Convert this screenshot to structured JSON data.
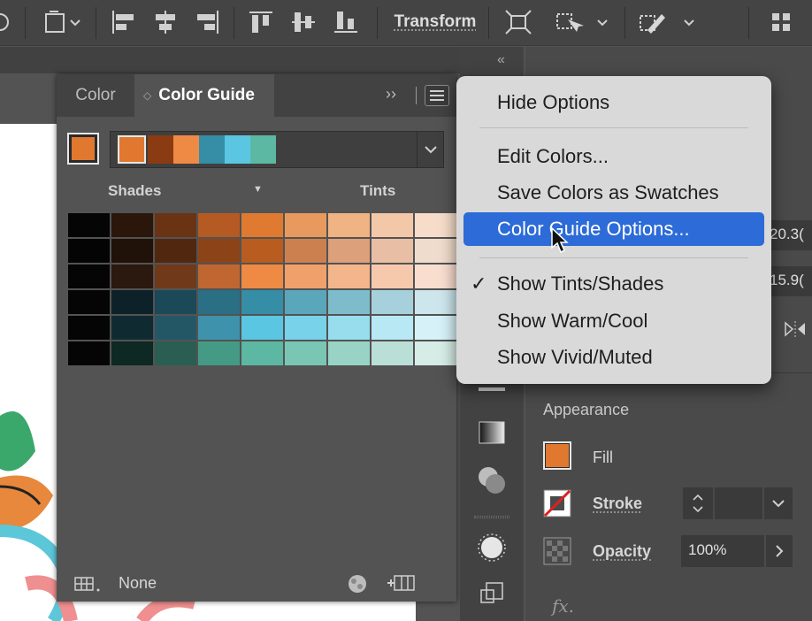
{
  "toolbar": {
    "transform_label": "Transform"
  },
  "panel": {
    "tabs": [
      {
        "label": "Color",
        "active": false
      },
      {
        "label": "Color Guide",
        "active": true
      }
    ],
    "base_color": "#e0782f",
    "harmony_colors": [
      "#e0782f",
      "#8a3b12",
      "#ef8a45",
      "#358ea6",
      "#5ac6e2",
      "#5cb8a2"
    ],
    "shades_label": "Shades",
    "tints_label": "Tints",
    "grid_colors": [
      [
        "#050505",
        "#2a160b",
        "#6a3314",
        "#b45a22",
        "#e07a30",
        "#e89a5e",
        "#efb384",
        "#f3c8a8",
        "#f6dcc9"
      ],
      [
        "#040404",
        "#201208",
        "#512710",
        "#8c4317",
        "#b85c20",
        "#cc8050",
        "#dca07a",
        "#e8bfa4",
        "#f0dccc"
      ],
      [
        "#050505",
        "#2b180e",
        "#70391a",
        "#c06630",
        "#ef8a45",
        "#f0a06a",
        "#f3b58c",
        "#f6c9ad",
        "#f9ded0"
      ],
      [
        "#050505",
        "#0d2228",
        "#1c4957",
        "#2a6f84",
        "#358ea6",
        "#5aa6ba",
        "#7fbccb",
        "#a6d1dc",
        "#cde6ec"
      ],
      [
        "#050505",
        "#102a32",
        "#245766",
        "#3f92ab",
        "#5ac6e2",
        "#78d2e9",
        "#97ddee",
        "#b8e8f3",
        "#d6f2f8"
      ],
      [
        "#050505",
        "#0e2823",
        "#2a5e52",
        "#449a85",
        "#5cb8a2",
        "#7ac6b4",
        "#99d3c5",
        "#badfd6",
        "#d6ece6"
      ]
    ],
    "footer_label": "None"
  },
  "menu": {
    "items": [
      {
        "label": "Hide Options",
        "checked": false,
        "highlighted": false
      },
      {
        "label": "Edit Colors...",
        "checked": false,
        "highlighted": false
      },
      {
        "label": "Save Colors as Swatches",
        "checked": false,
        "highlighted": false
      },
      {
        "label": "Color Guide Options...",
        "checked": false,
        "highlighted": true
      },
      {
        "label": "Show Tints/Shades",
        "checked": true,
        "highlighted": false
      },
      {
        "label": "Show Warm/Cool",
        "checked": false,
        "highlighted": false
      },
      {
        "label": "Show Vivid/Muted",
        "checked": false,
        "highlighted": false
      }
    ],
    "check_glyph": "✓"
  },
  "properties": {
    "value_1": "20.3(",
    "value_2": "15.9(",
    "appearance_label": "Appearance",
    "fill_label": "Fill",
    "fill_color": "#e0782f",
    "stroke_label": "Stroke",
    "opacity_label": "Opacity",
    "opacity_value": "100%",
    "fx_label": "fx."
  },
  "icons": [
    "collapse-icon",
    "grid-icon",
    "panel-menu-icon",
    "chevron-down-icon",
    "gradient-icon",
    "pathfinder-icon",
    "symbol-icon",
    "artboard-icon"
  ]
}
